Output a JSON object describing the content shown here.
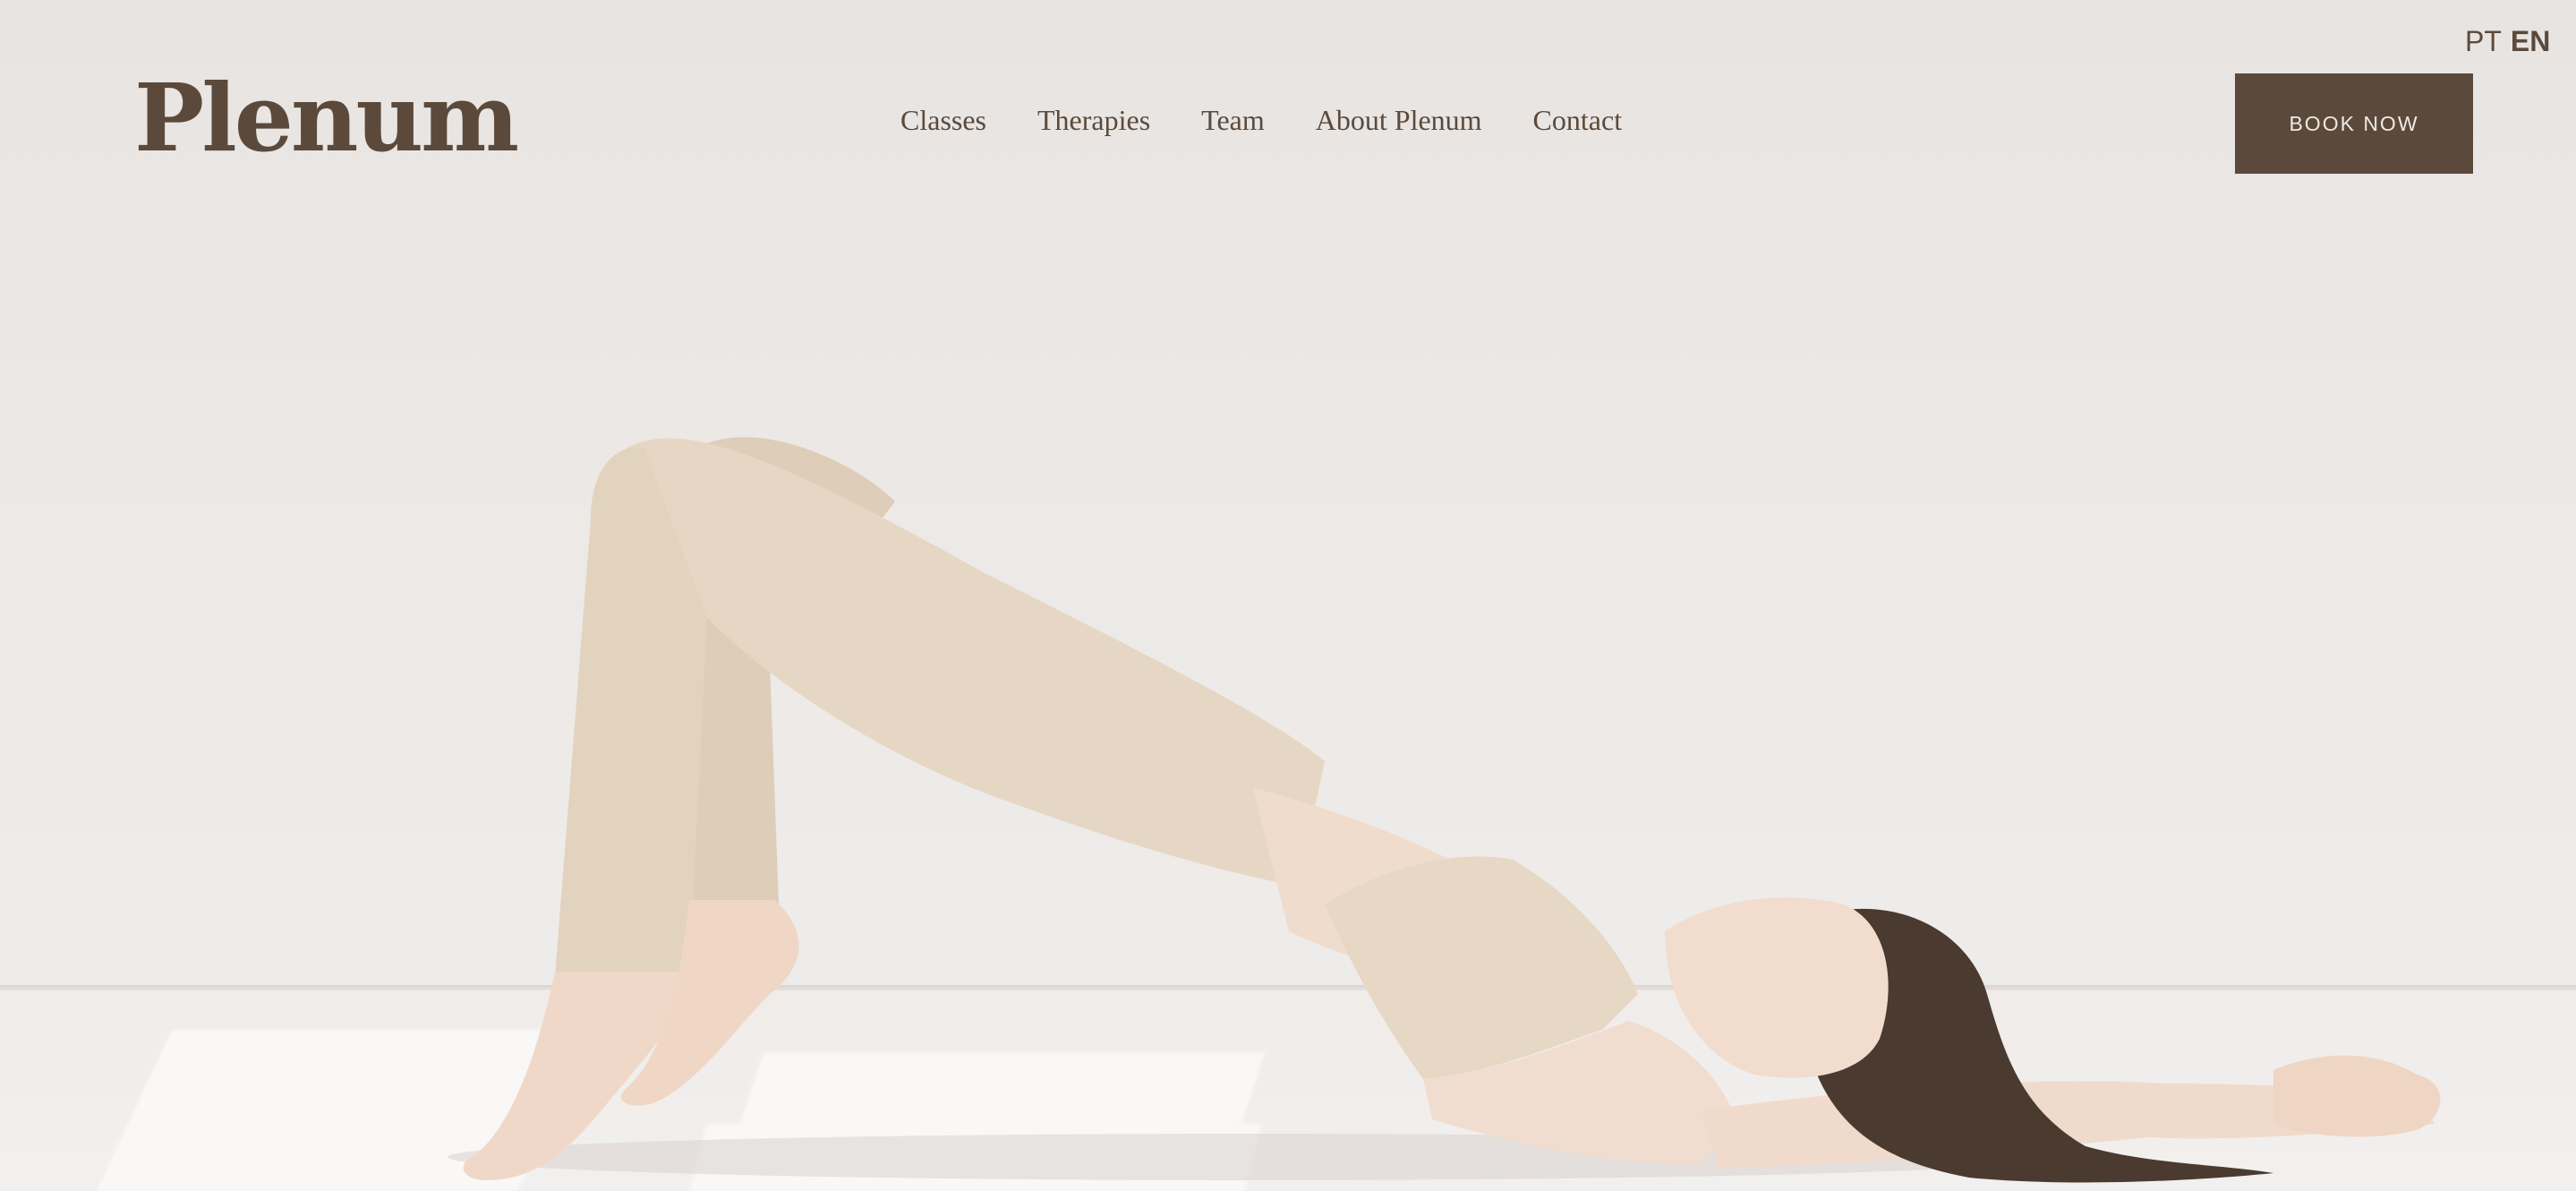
{
  "brand": {
    "logo_text": "Plenum"
  },
  "nav": {
    "items": [
      "Classes",
      "Therapies",
      "Team",
      "About Plenum",
      "Contact"
    ]
  },
  "language": {
    "options": [
      "PT",
      "EN"
    ],
    "selected": "EN"
  },
  "cta": {
    "label": "BOOK NOW",
    "color": "#5b4a3b"
  },
  "hero": {
    "image": "woman-bridge-pose-photo"
  },
  "colors": {
    "brand": "#5b4a3b",
    "background": "#e9e6e4",
    "outfit": "#e6d8c6"
  }
}
